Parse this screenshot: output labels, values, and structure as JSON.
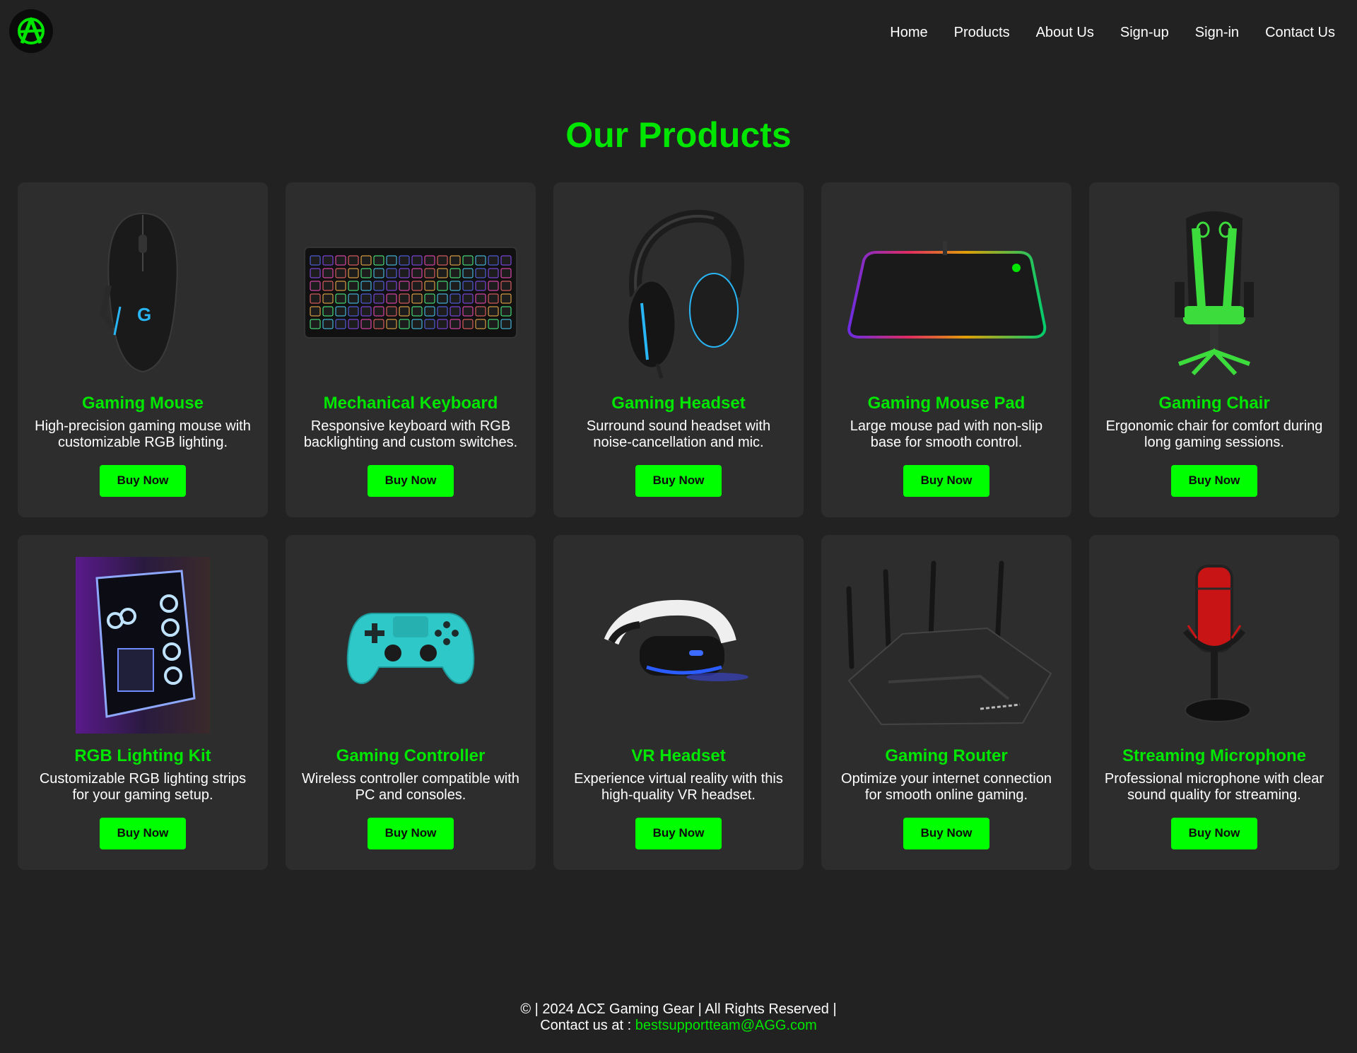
{
  "brand": {
    "logo_icon": "anarchy-a-icon",
    "accent": "#00e600",
    "button_color": "#00ff00"
  },
  "nav": {
    "items": [
      {
        "label": "Home"
      },
      {
        "label": "Products"
      },
      {
        "label": "About Us"
      },
      {
        "label": "Sign-up"
      },
      {
        "label": "Sign-in"
      },
      {
        "label": "Contact Us"
      }
    ]
  },
  "page": {
    "title": "Our Products"
  },
  "products": [
    {
      "name": "Gaming Mouse",
      "desc": "High-precision gaming mouse with customizable RGB lighting.",
      "button": "Buy Now",
      "image_icon": "gaming-mouse-image"
    },
    {
      "name": "Mechanical Keyboard",
      "desc": "Responsive keyboard with RGB backlighting and custom switches.",
      "button": "Buy Now",
      "image_icon": "keyboard-image"
    },
    {
      "name": "Gaming Headset",
      "desc": "Surround sound headset with noise-cancellation and mic.",
      "button": "Buy Now",
      "image_icon": "headset-image"
    },
    {
      "name": "Gaming Mouse Pad",
      "desc": "Large mouse pad with non-slip base for smooth control.",
      "button": "Buy Now",
      "image_icon": "mouse-pad-image"
    },
    {
      "name": "Gaming Chair",
      "desc": "Ergonomic chair for comfort during long gaming sessions.",
      "button": "Buy Now",
      "image_icon": "gaming-chair-image"
    },
    {
      "name": "RGB Lighting Kit",
      "desc": "Customizable RGB lighting strips for your gaming setup.",
      "button": "Buy Now",
      "image_icon": "rgb-pc-case-image"
    },
    {
      "name": "Gaming Controller",
      "desc": "Wireless controller compatible with PC and consoles.",
      "button": "Buy Now",
      "image_icon": "controller-image"
    },
    {
      "name": "VR Headset",
      "desc": "Experience virtual reality with this high-quality VR headset.",
      "button": "Buy Now",
      "image_icon": "vr-headset-image"
    },
    {
      "name": "Gaming Router",
      "desc": "Optimize your internet connection for smooth online gaming.",
      "button": "Buy Now",
      "image_icon": "router-image"
    },
    {
      "name": "Streaming Microphone",
      "desc": "Professional microphone with clear sound quality for streaming.",
      "button": "Buy Now",
      "image_icon": "microphone-image"
    }
  ],
  "footer": {
    "line1": "© | 2024 ΔCΣ Gaming Gear | All Rights Reserved |",
    "contact_prefix": "Contact us at : ",
    "email": "bestsupportteam@AGG.com"
  }
}
